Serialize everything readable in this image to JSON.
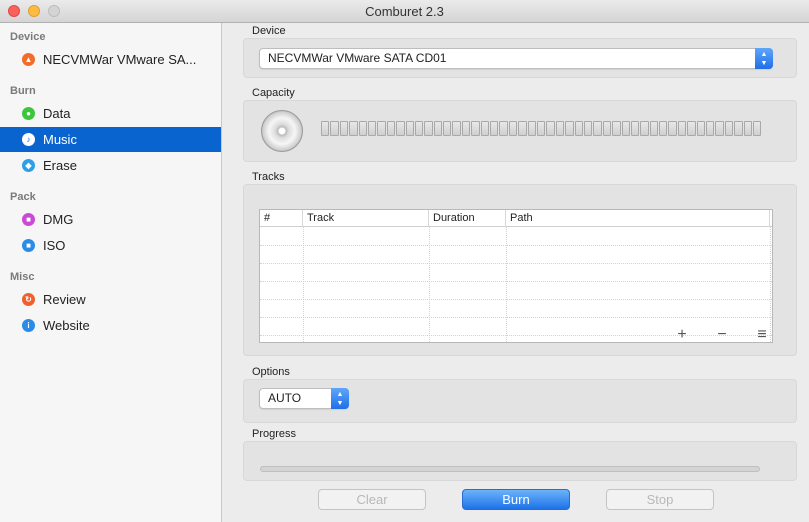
{
  "window": {
    "title": "Comburet 2.3"
  },
  "sidebar": {
    "sections": [
      {
        "label": "Device"
      },
      {
        "label": "Burn"
      },
      {
        "label": "Pack"
      },
      {
        "label": "Misc"
      }
    ],
    "items": [
      {
        "label": "NECVMWar VMware SA...",
        "icon": "flame-icon",
        "color": "#f26c2a"
      },
      {
        "label": "Data",
        "icon": "data-icon",
        "color": "#3cc63c"
      },
      {
        "label": "Music",
        "icon": "music-note-icon",
        "color": "#f0456e",
        "selected": true
      },
      {
        "label": "Erase",
        "icon": "eraser-icon",
        "color": "#2d9fe6"
      },
      {
        "label": "DMG",
        "icon": "dmg-icon",
        "color": "#c94ad6"
      },
      {
        "label": "ISO",
        "icon": "iso-icon",
        "color": "#2a8ce6"
      },
      {
        "label": "Review",
        "icon": "review-icon",
        "color": "#f0602e"
      },
      {
        "label": "Website",
        "icon": "info-icon",
        "color": "#2a8ce6"
      }
    ]
  },
  "device": {
    "label": "Device",
    "selected": "NECVMWar VMware SATA CD01"
  },
  "capacity": {
    "label": "Capacity",
    "fill": 0
  },
  "tracks": {
    "label": "Tracks",
    "columns": [
      "#",
      "Track",
      "Duration",
      "Path"
    ],
    "rows": [],
    "add": "+",
    "remove": "−",
    "menu": "≡"
  },
  "options": {
    "label": "Options",
    "selected": "AUTO"
  },
  "progress": {
    "label": "Progress",
    "value": 0
  },
  "buttons": {
    "clear": "Clear",
    "burn": "Burn",
    "stop": "Stop"
  }
}
